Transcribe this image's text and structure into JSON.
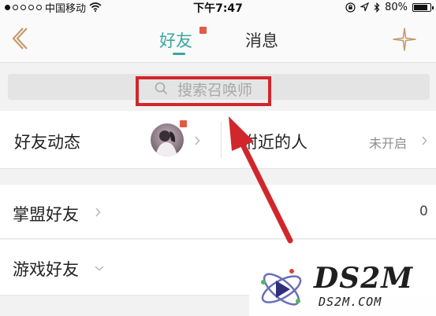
{
  "status_bar": {
    "carrier": "中国移动",
    "time": "下午7:47",
    "battery": "80%",
    "battery_level": 0.8
  },
  "nav": {
    "tab_friends": "好友",
    "tab_messages": "消息",
    "active_tab": "好友"
  },
  "search": {
    "placeholder": "搜索召唤师"
  },
  "friend_activity": {
    "label": "好友动态"
  },
  "nearby": {
    "label": "附近的人",
    "status": "未开启"
  },
  "groups": [
    {
      "label": "掌盟好友",
      "count": "0"
    },
    {
      "label": "游戏好友"
    }
  ],
  "watermark": {
    "title": "DS2M",
    "subtitle": "DS2M.COM"
  },
  "colors": {
    "accent": "#3aa7a3",
    "badge": "#e35a47",
    "annotation_red": "#d1262b"
  },
  "icons": {
    "back": "back-chevron-icon",
    "add": "compass-star-icon",
    "search": "search-icon"
  }
}
